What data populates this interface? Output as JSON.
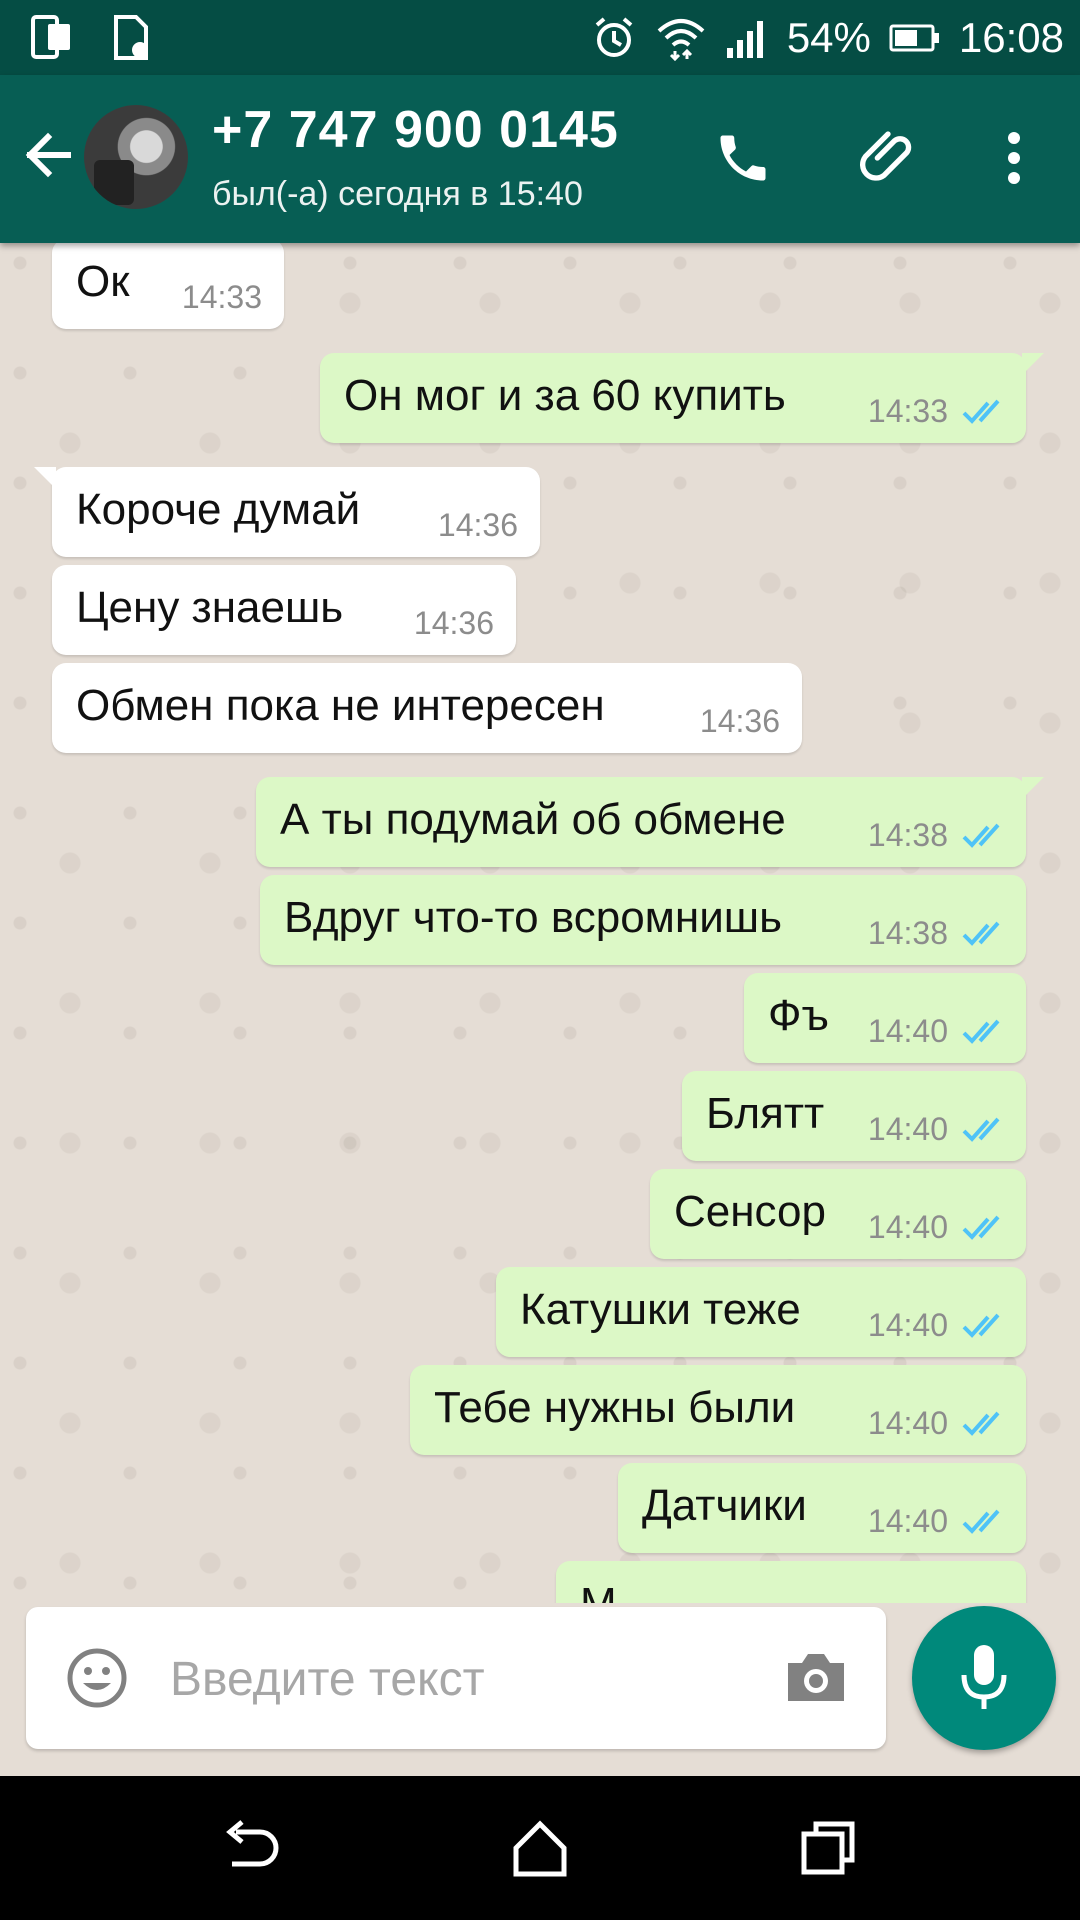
{
  "status_bar": {
    "battery": "54%",
    "time": "16:08"
  },
  "header": {
    "contact": "+7 747 900 0145",
    "last_seen": "был(-а) сегодня в 15:40"
  },
  "messages": [
    {
      "dir": "in",
      "text": "Ок",
      "time": "14:33"
    },
    {
      "dir": "out",
      "text": "Он мог и за 60 купить",
      "time": "14:33"
    },
    {
      "dir": "in",
      "text": "Короче думай",
      "time": "14:36"
    },
    {
      "dir": "in",
      "text": "Цену знаешь",
      "time": "14:36"
    },
    {
      "dir": "in",
      "text": "Обмен пока не интересен",
      "time": "14:36"
    },
    {
      "dir": "out",
      "text": "А ты подумай об обмене",
      "time": "14:38"
    },
    {
      "dir": "out",
      "text": "Вдруг что-то всромнишь",
      "time": "14:38"
    },
    {
      "dir": "out",
      "text": "Фъ",
      "time": "14:40"
    },
    {
      "dir": "out",
      "text": "Блятт",
      "time": "14:40"
    },
    {
      "dir": "out",
      "text": "Сенсор",
      "time": "14:40"
    },
    {
      "dir": "out",
      "text": "Катушки теже",
      "time": "14:40"
    },
    {
      "dir": "out",
      "text": "Тебе нужны были",
      "time": "14:40"
    },
    {
      "dir": "out",
      "text": "Датчики",
      "time": "14:40"
    },
    {
      "dir": "out",
      "text": "М",
      "time": ""
    }
  ],
  "composer": {
    "placeholder": "Введите текст"
  },
  "colors": {
    "header": "#075e54",
    "status_bar": "#054d44",
    "outgoing_bubble": "#dcf8c6",
    "incoming_bubble": "#ffffff",
    "read_ticks": "#4fc3f7",
    "mic_button": "#00897b"
  }
}
